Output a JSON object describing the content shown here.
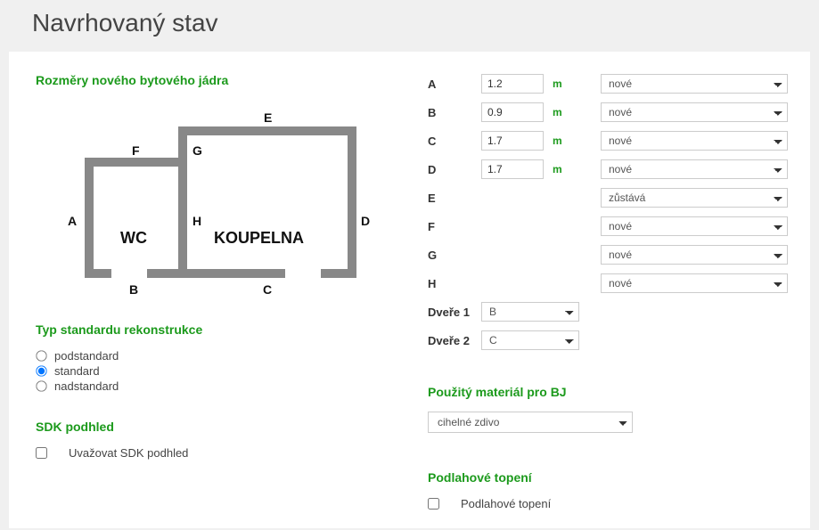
{
  "page": {
    "title": "Navrhovaný stav"
  },
  "sections": {
    "dimensions_title": "Rozměry nového bytového jádra",
    "standard_title": "Typ standardu rekonstrukce",
    "sdk_title": "SDK podhled",
    "material_title": "Použitý materiál pro BJ",
    "floor_heating_title": "Podlahové topení"
  },
  "floorplan": {
    "labels": {
      "A": "A",
      "B": "B",
      "C": "C",
      "D": "D",
      "E": "E",
      "F": "F",
      "G": "G",
      "H": "H"
    },
    "rooms": {
      "wc": "WC",
      "bath": "KOUPELNA"
    }
  },
  "dims": {
    "A": {
      "value": "1.2",
      "unit": "m",
      "status": "nové"
    },
    "B": {
      "value": "0.9",
      "unit": "m",
      "status": "nové"
    },
    "C": {
      "value": "1.7",
      "unit": "m",
      "status": "nové"
    },
    "D": {
      "value": "1.7",
      "unit": "m",
      "status": "nové"
    },
    "E": {
      "status": "zůstává"
    },
    "F": {
      "status": "nové"
    },
    "G": {
      "status": "nové"
    },
    "H": {
      "status": "nové"
    }
  },
  "doors": {
    "d1_label": "Dveře 1",
    "d1_value": "B",
    "d2_label": "Dveře 2",
    "d2_value": "C"
  },
  "standard": {
    "opt1": "podstandard",
    "opt2": "standard",
    "opt3": "nadstandard",
    "selected": "standard"
  },
  "material": {
    "value": "cihelné zdivo"
  },
  "sdk": {
    "label": "Uvažovat SDK podhled",
    "checked": false
  },
  "floor_heating": {
    "label": "Podlahové topení",
    "checked": false
  }
}
